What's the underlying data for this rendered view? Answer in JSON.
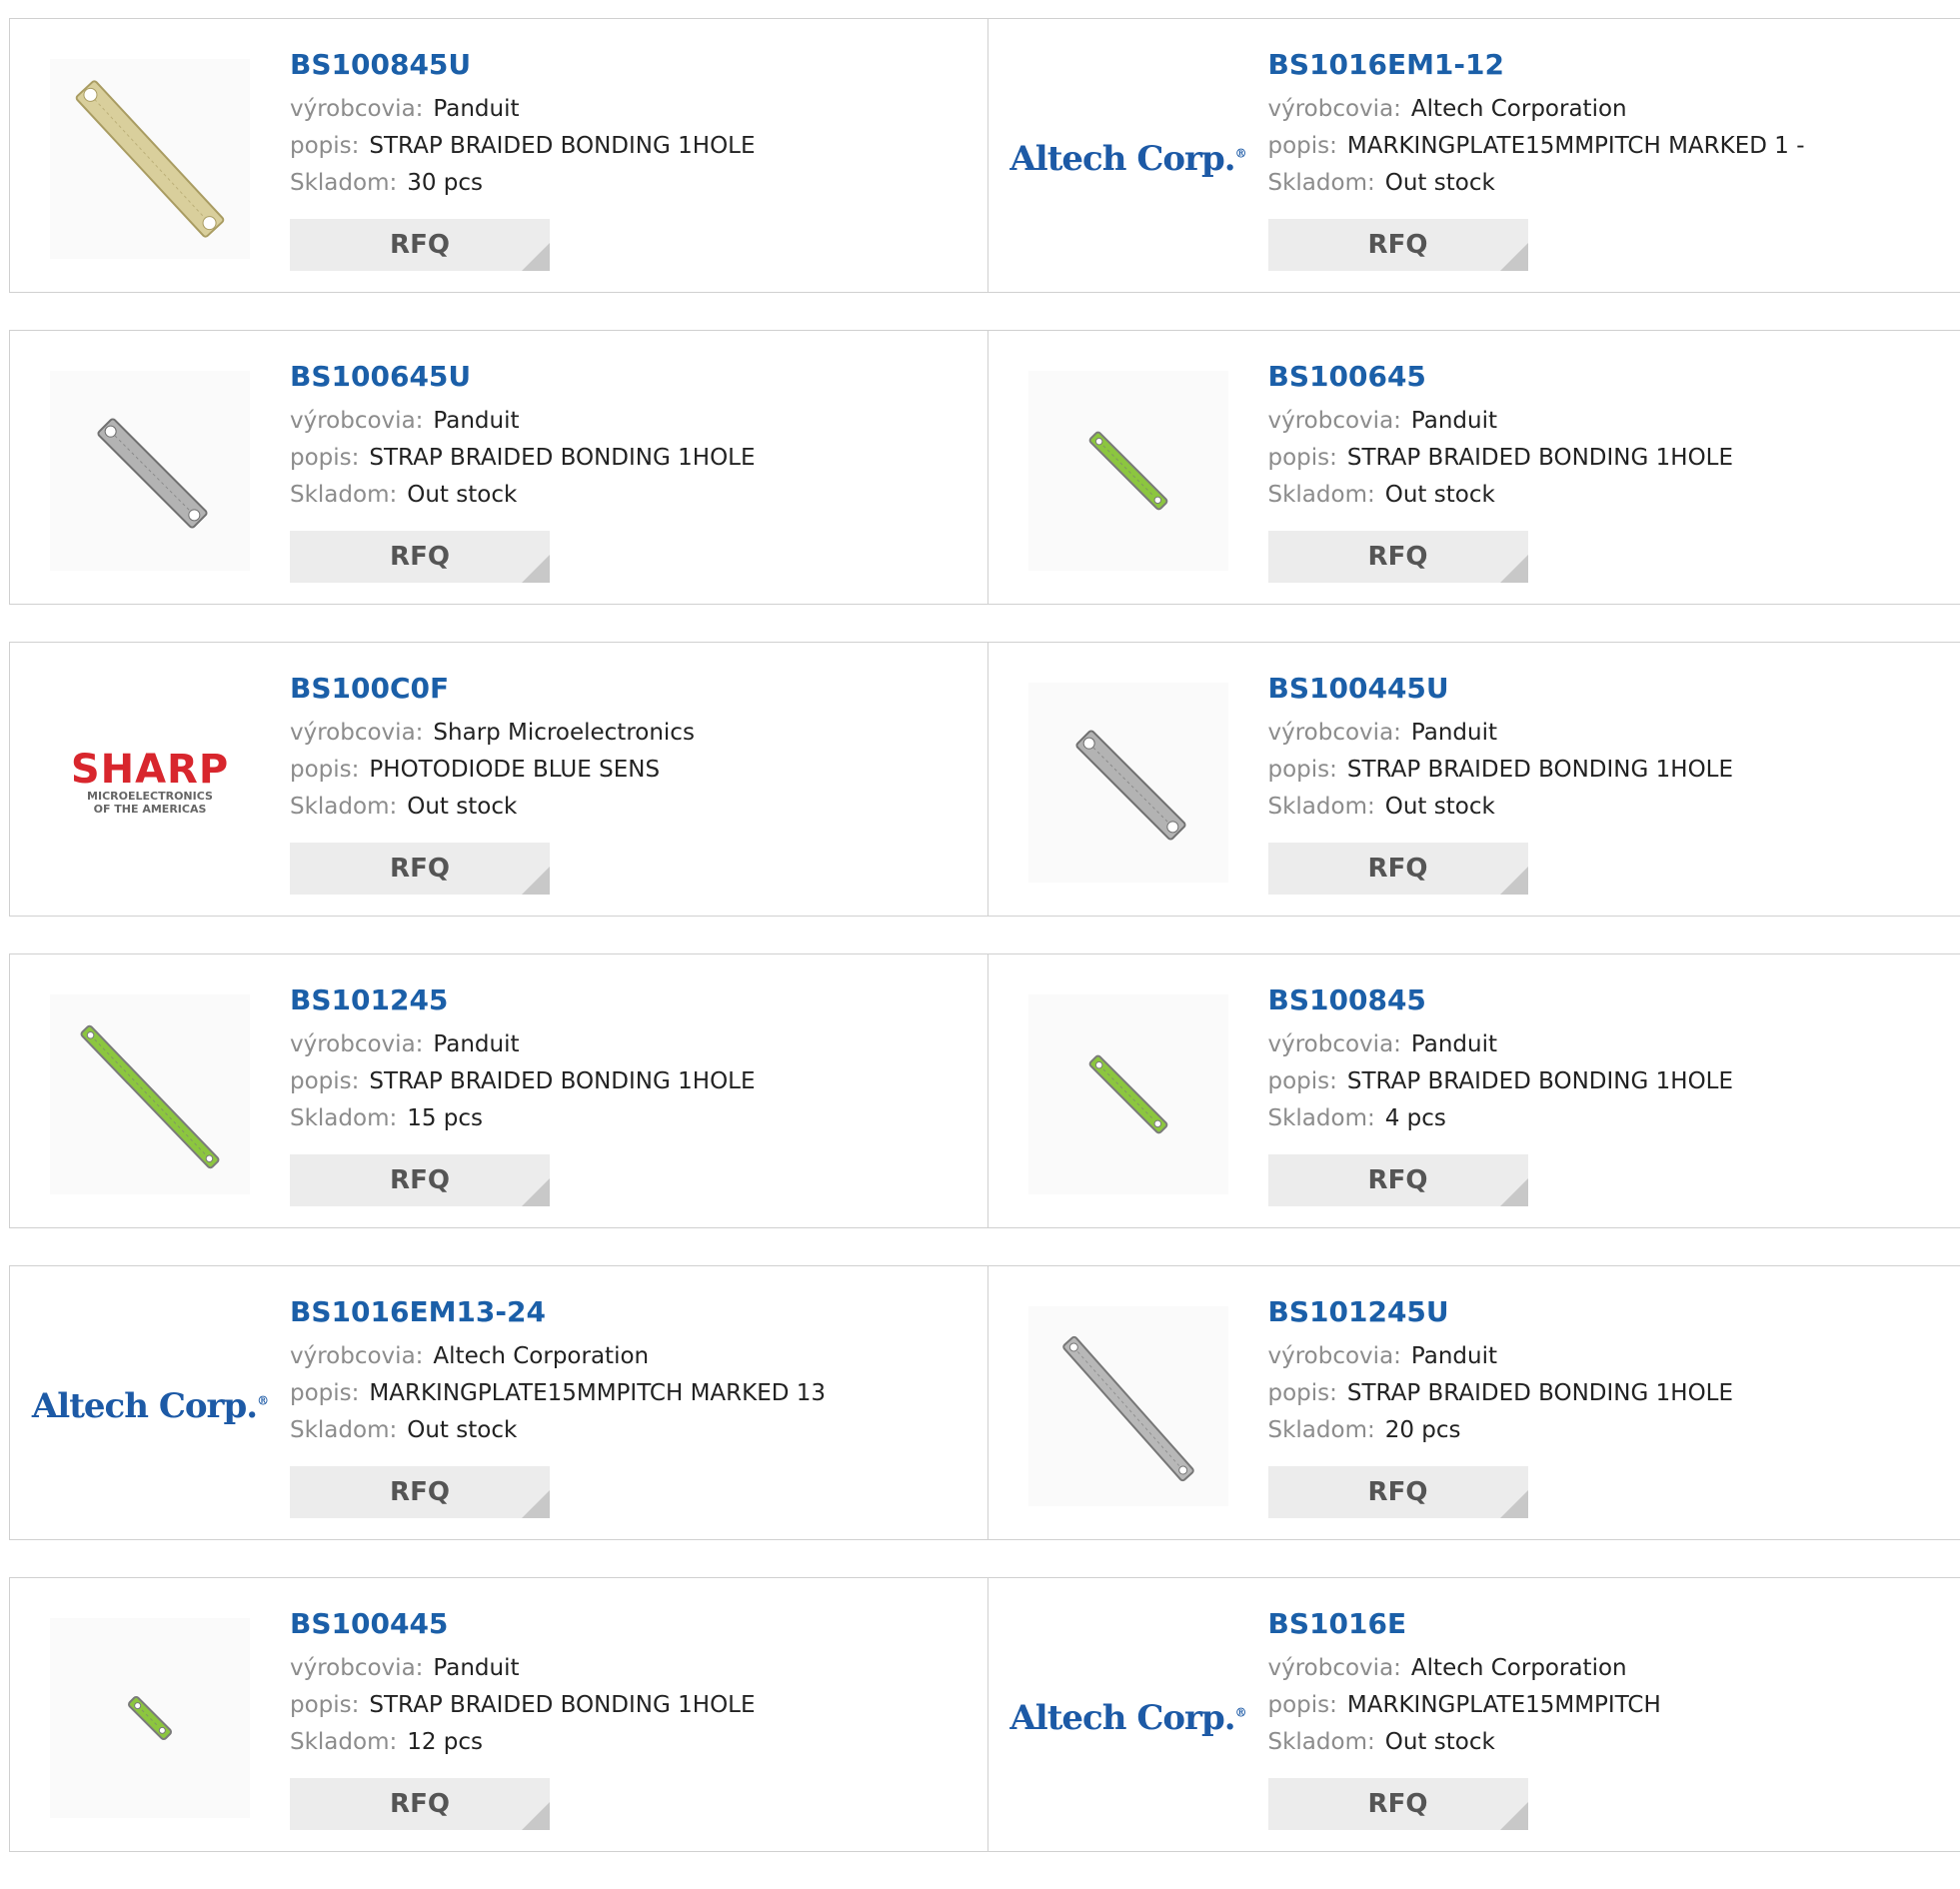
{
  "labels": {
    "manufacturer": "výrobcovia:",
    "description": "popis:",
    "stock": "Skladom:",
    "rfq": "RFQ"
  },
  "products": [
    {
      "part": "BS100845U",
      "manufacturer": "Panduit",
      "description": "STRAP BRAIDED BONDING 1HOLE",
      "stock": "30 pcs",
      "image": "braided-strap-tinned-icon"
    },
    {
      "part": "BS1016EM1-12",
      "manufacturer": "Altech Corporation",
      "description": "MARKINGPLATE15MMPITCH MARKED 1 -",
      "stock": "Out stock",
      "image": "altech-logo",
      "logo_text": "Altech Corp.",
      "logo_mark": "®"
    },
    {
      "part": "BS100645U",
      "manufacturer": "Panduit",
      "description": "STRAP BRAIDED BONDING 1HOLE",
      "stock": "Out stock",
      "image": "braided-strap-gray-icon"
    },
    {
      "part": "BS100645",
      "manufacturer": "Panduit",
      "description": "STRAP BRAIDED BONDING 1HOLE",
      "stock": "Out stock",
      "image": "green-strap-icon"
    },
    {
      "part": "BS100C0F",
      "manufacturer": "Sharp Microelectronics",
      "description": "PHOTODIODE BLUE SENS",
      "stock": "Out stock",
      "image": "sharp-logo",
      "logo_text": "SHARP",
      "logo_sub1": "MICROELECTRONICS",
      "logo_sub2": "OF THE AMERICAS"
    },
    {
      "part": "BS100445U",
      "manufacturer": "Panduit",
      "description": "STRAP BRAIDED BONDING 1HOLE",
      "stock": "Out stock",
      "image": "braided-strap-gray-icon"
    },
    {
      "part": "BS101245",
      "manufacturer": "Panduit",
      "description": "STRAP BRAIDED BONDING 1HOLE",
      "stock": "15 pcs",
      "image": "green-strap-long-icon"
    },
    {
      "part": "BS100845",
      "manufacturer": "Panduit",
      "description": "STRAP BRAIDED BONDING 1HOLE",
      "stock": "4 pcs",
      "image": "green-strap-icon"
    },
    {
      "part": "BS1016EM13-24",
      "manufacturer": "Altech Corporation",
      "description": "MARKINGPLATE15MMPITCH MARKED 13",
      "stock": "Out stock",
      "image": "altech-logo",
      "logo_text": "Altech Corp.",
      "logo_mark": "®"
    },
    {
      "part": "BS101245U",
      "manufacturer": "Panduit",
      "description": "STRAP BRAIDED BONDING 1HOLE",
      "stock": "20 pcs",
      "image": "braided-strap-long-icon"
    },
    {
      "part": "BS100445",
      "manufacturer": "Panduit",
      "description": "STRAP BRAIDED BONDING 1HOLE",
      "stock": "12 pcs",
      "image": "green-strap-short-icon"
    },
    {
      "part": "BS1016E",
      "manufacturer": "Altech Corporation",
      "description": "MARKINGPLATE15MMPITCH",
      "stock": "Out stock",
      "image": "altech-logo",
      "logo_text": "Altech Corp.",
      "logo_mark": "®"
    }
  ],
  "colors": {
    "link": "#1b5fa8",
    "label": "#8c8c8c",
    "button_bg": "#ececec",
    "border": "#d0d0d0",
    "sharp_red": "#d8262d",
    "altech_blue": "#1d5aa6",
    "strap_green": "#7bc043"
  }
}
